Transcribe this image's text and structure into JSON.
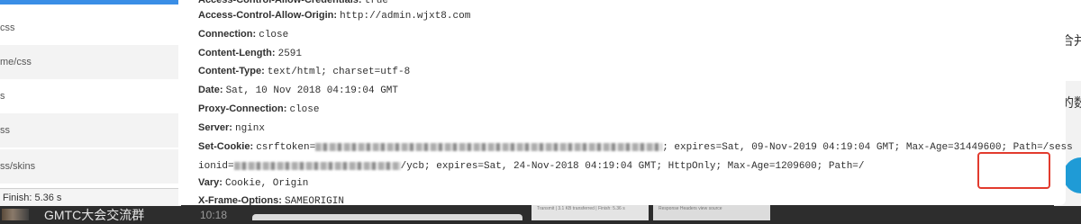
{
  "left_list": {
    "rows": [
      "css",
      "me/css",
      "s",
      "ss",
      "s",
      "ss/skins"
    ],
    "footer": "Finish: 5.36 s"
  },
  "chat": {
    "title": "GMTC大会交流群",
    "time": "10:18"
  },
  "headers": [
    {
      "key": "Access-Control-Allow-Credentials:",
      "value": "true"
    },
    {
      "key": "Access-Control-Allow-Origin:",
      "value": "http://admin.wjxt8.com"
    },
    {
      "key": "Connection:",
      "value": "close"
    },
    {
      "key": "Content-Length:",
      "value": "2591"
    },
    {
      "key": "Content-Type:",
      "value": "text/html; charset=utf-8"
    },
    {
      "key": "Date:",
      "value": "Sat, 10 Nov 2018 04:19:04 GMT"
    },
    {
      "key": "Proxy-Connection:",
      "value": "close"
    },
    {
      "key": "Server:",
      "value": "nginx"
    },
    {
      "key": "Set-Cookie:",
      "value_pre": "csrftoken=",
      "value_post": "; expires=Sat, 09-Nov-2019 04:19:04 GMT; Max-Age=31449600; Path=/sess"
    },
    {
      "key": "",
      "value_pre": "ionid=",
      "value_post": "/ycb; expires=Sat, 24-Nov-2018 04:19:04 GMT; HttpOnly; Max-Age=1209600; Path=/"
    },
    {
      "key": "Vary:",
      "value": "Cookie, Origin"
    },
    {
      "key": "X-Frame-Options:",
      "value": "SAMEORIGIN"
    }
  ],
  "right_app": {
    "chars": [
      "合并",
      "的数"
    ]
  },
  "thumbnails": {
    "left_caption": "Transmit | 3.1 KB transferred | Finish: 5.36 s",
    "right_caption": "Response Headers   view source"
  },
  "colors": {
    "highlight": "#e23b2e",
    "accent": "#1f9bd6"
  }
}
